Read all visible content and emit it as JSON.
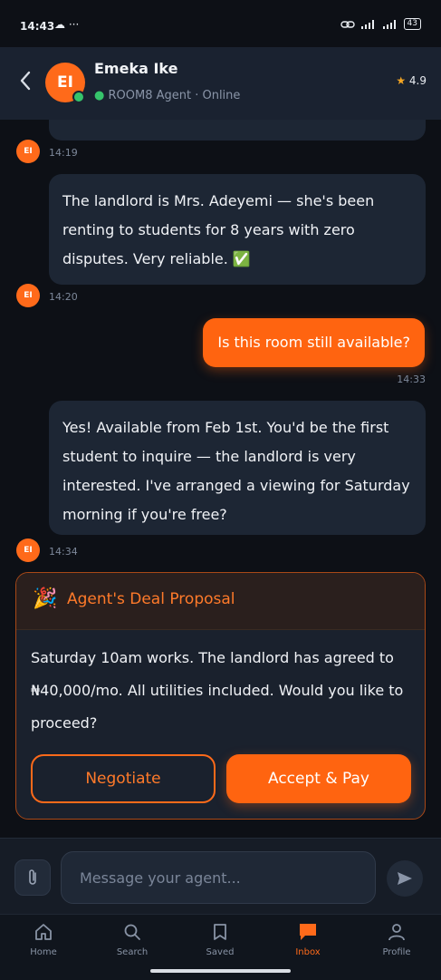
{
  "status_bar": {
    "time": "14:43",
    "left_icons": "☁ ···",
    "battery": "43"
  },
  "header": {
    "back_icon": "chevron-left-icon",
    "avatar_initials": "EI",
    "agent_name": "Emeka Ike",
    "agent_subtitle": "ROOM8 Agent · Online",
    "rating": "4.9"
  },
  "messages": [
    {
      "from": "agent",
      "avatar": "EI",
      "time": "14:19"
    },
    {
      "from": "agent",
      "text": "The landlord is Mrs. Adeyemi — she's been renting to students for 8 years with zero disputes. Very reliable. ✅",
      "avatar": "EI",
      "time": "14:20"
    },
    {
      "from": "user",
      "text": "Is this room still available?",
      "time": "14:33"
    },
    {
      "from": "agent",
      "text": "Yes! Available from Feb 1st. You'd be the first student to inquire — the landlord is very interested. I've arranged a viewing for Saturday morning if you're free?",
      "avatar": "EI",
      "time": "14:34"
    }
  ],
  "deal": {
    "emoji": "🎉",
    "title": "Agent's Deal Proposal",
    "body": "Saturday 10am works. The landlord has agreed to ₦40,000/mo. All utilities included. Would you like to proceed?",
    "negotiate_label": "Negotiate",
    "accept_label": "Accept & Pay"
  },
  "composer": {
    "placeholder": "Message your agent..."
  },
  "tabs": [
    {
      "label": "Home",
      "icon": "home-icon"
    },
    {
      "label": "Search",
      "icon": "search-icon"
    },
    {
      "label": "Saved",
      "icon": "bookmark-icon"
    },
    {
      "label": "Inbox",
      "icon": "inbox-icon",
      "active": true
    },
    {
      "label": "Profile",
      "icon": "profile-icon"
    }
  ],
  "colors": {
    "accent": "#ff6410",
    "background": "#0d1016",
    "bubble": "#1d2634",
    "online": "#36c46b"
  }
}
